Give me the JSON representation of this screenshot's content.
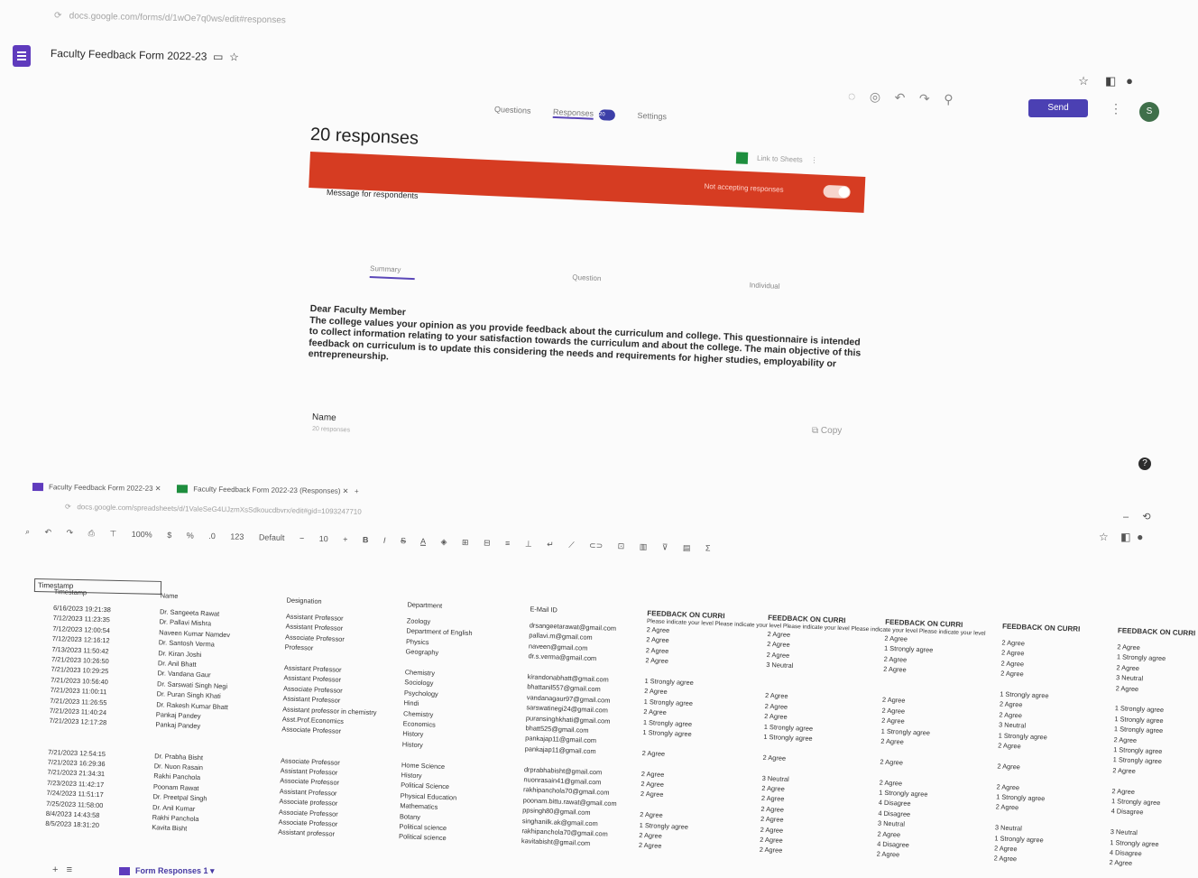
{
  "browser_top": {
    "url": "docs.google.com/forms/d/1wOe7q0ws/edit#responses",
    "form_title": "Faculty Feedback Form 2022-23",
    "send_label": "Send",
    "avatar_letter": "S",
    "tabs": [
      "Questions",
      "Responses",
      "Settings"
    ],
    "responses_badge": "20"
  },
  "responses": {
    "count_label": "20 responses",
    "link_sheets_label": "Link to Sheets",
    "accepting_label": "Not accepting responses",
    "message_label": "Message for respondents",
    "subtabs": [
      "Summary",
      "Question",
      "Individual"
    ],
    "paragraph_title": "Dear Faculty Member",
    "paragraph_text": "The college values your opinion as you provide feedback about the curriculum and college. This questionnaire is intended to collect information relating to your satisfaction towards the curriculum and about the college. The main objective of this feedback on curriculum is to update this considering the needs and requirements for higher studies, employability or entrepreneurship.",
    "name_label": "Name",
    "name_sub": "20 responses",
    "copy_label": "Copy"
  },
  "browser_bottom": {
    "tabs": [
      "Faculty Feedback Form 2022-23",
      "Faculty Feedback Form 2022-23 (Responses)"
    ],
    "url": "docs.google.com/spreadsheets/d/1ValeSeG4UJzmXsSdkoucdbvrx/edit#gid=1093247710",
    "zoom": "100%",
    "font": "Default",
    "font_size": "10",
    "name_box": "Timestamp",
    "sheet_tab": "Form Responses 1"
  },
  "sheet": {
    "headers": [
      "Timestamp",
      "Name",
      "Designation",
      "Department",
      "E-Mail ID",
      "FEEDBACK ON CURRI",
      "FEEDBACK ON CURRI",
      "FEEDBACK ON CURRI",
      "FEEDBACK ON CURRI",
      "FEEDBACK ON CURRI"
    ],
    "subheader": "Please indicate your level  Please indicate your level  Please indicate your level  Please indicate your level  Please indicate your level",
    "rows": [
      [
        "6/16/2023 19:21:38",
        "Dr. Sangeeta Rawat",
        "Assistant Professor",
        "Zoology",
        "drsangeetarawat@gmail.com",
        "2 Agree",
        "2 Agree",
        "2 Agree",
        "2 Agree",
        "2 Agree"
      ],
      [
        "7/12/2023 11:23:35",
        "Dr. Pallavi Mishra",
        "Assistant Professor",
        "Department of English",
        "pallavi.m@gmail.com",
        "2 Agree",
        "2 Agree",
        "1 Strongly agree",
        "2 Agree",
        "1 Strongly agree"
      ],
      [
        "7/12/2023 12:00:54",
        "Naveen Kumar Namdev",
        "Associate Professor",
        "Physics",
        "naveen@gmail.com",
        "2 Agree",
        "2 Agree",
        "2 Agree",
        "2 Agree",
        "2 Agree"
      ],
      [
        "7/12/2023 12:16:12",
        "Dr. Santosh Verma",
        "Professor",
        "Geography",
        "dr.s.verma@gmail.com",
        "2 Agree",
        "3 Neutral",
        "2 Agree",
        "2 Agree",
        "3 Neutral"
      ],
      [
        "7/13/2023 11:50:42",
        "Dr. Kiran Joshi",
        "",
        "",
        "",
        "",
        "",
        "",
        "",
        "2 Agree"
      ],
      [
        "7/21/2023 10:26:50",
        "Dr. Anil Bhatt",
        "Assistant Professor",
        "Chemistry",
        "kirandonabhatt@gmail.com",
        "1 Strongly agree",
        "",
        "",
        "1 Strongly agree",
        ""
      ],
      [
        "7/21/2023 10:29:25",
        "Dr. Vandana Gaur",
        "Assistant Professor",
        "Sociology",
        "bhattanil557@gmail.com",
        "2 Agree",
        "2 Agree",
        "2 Agree",
        "2 Agree",
        "1 Strongly agree"
      ],
      [
        "7/21/2023 10:56:40",
        "Dr. Sarswati Singh Negi",
        "Associate Professor",
        "Psychology",
        "vandanagaur97@gmail.com",
        "1 Strongly agree",
        "2 Agree",
        "2 Agree",
        "2 Agree",
        "1 Strongly agree"
      ],
      [
        "7/21/2023 11:00:11",
        "Dr. Puran Singh Khati",
        "Assistant Professor",
        "Hindi",
        "sarswatinegi24@gmail.com",
        "2 Agree",
        "2 Agree",
        "2 Agree",
        "3 Neutral",
        "1 Strongly agree"
      ],
      [
        "7/21/2023 11:26:55",
        "Dr. Rakesh Kumar Bhatt",
        "Assistant professor in chemistry",
        "Chemistry",
        "puransinghkhati@gmail.com",
        "1 Strongly agree",
        "1 Strongly agree",
        "1 Strongly agree",
        "1 Strongly agree",
        "2 Agree"
      ],
      [
        "7/21/2023 11:40:24",
        "Pankaj Pandey",
        "Asst.Prof.Economics",
        "Economics",
        "bhatt525@gmail.com",
        "1 Strongly agree",
        "1 Strongly agree",
        "2 Agree",
        "2 Agree",
        "1 Strongly agree"
      ],
      [
        "7/21/2023 12:17:28",
        "Pankaj Pandey",
        "Associate Professor",
        "History",
        "pankajap11@gmail.com",
        "",
        "",
        "",
        "",
        "1 Strongly agree"
      ],
      [
        "",
        "",
        "",
        "History",
        "pankajap11@gmail.com",
        "2 Agree",
        "2 Agree",
        "2 Agree",
        "2 Agree",
        "2 Agree"
      ],
      [
        "",
        "",
        "",
        "",
        "",
        "",
        "",
        "",
        "",
        ""
      ],
      [
        "7/21/2023 12:54:15",
        "Dr. Prabha Bisht",
        "Associate Professor",
        "Home Science",
        "drprabhabisht@gmail.com",
        "2 Agree",
        "3 Neutral",
        "2 Agree",
        "2 Agree",
        "2 Agree"
      ],
      [
        "7/21/2023 16:29:36",
        "Dr. Nuon Rasain",
        "Assistant Professor",
        "History",
        "nuonrasain41@gmail.com",
        "2 Agree",
        "2 Agree",
        "1 Strongly agree",
        "1 Strongly agree",
        "1 Strongly agree"
      ],
      [
        "7/21/2023 21:34:31",
        "Rakhi Panchola",
        "Associate Professor",
        "Political Science",
        "rakhipanchola70@gmail.com",
        "2 Agree",
        "2 Agree",
        "4 Disagree",
        "2 Agree",
        "4 Disagree"
      ],
      [
        "7/23/2023 11:42:17",
        "Poonam Rawat",
        "Assistant Professor",
        "Physical Education",
        "poonam.bittu.rawat@gmail.com",
        "",
        "2 Agree",
        "4 Disagree",
        "",
        ""
      ],
      [
        "7/24/2023 11:51:17",
        "Dr. Preetpal Singh",
        "Associate professor",
        "Mathematics",
        "ppsingh80@gmail.com",
        "2 Agree",
        "2 Agree",
        "3 Neutral",
        "3 Neutral",
        "3 Neutral"
      ],
      [
        "7/25/2023 11:58:00",
        "Dr. Anil Kumar",
        "Associate Professor",
        "Botany",
        "singhanilk.ak@gmail.com",
        "1 Strongly agree",
        "2 Agree",
        "2 Agree",
        "1 Strongly agree",
        "1 Strongly agree"
      ],
      [
        "8/4/2023 14:43:58",
        "Rakhi Panchola",
        "Associate Professor",
        "Political science",
        "rakhipanchola70@gmail.com",
        "2 Agree",
        "2 Agree",
        "4 Disagree",
        "2 Agree",
        "4 Disagree"
      ],
      [
        "8/5/2023 18:31:20",
        "Kavita Bisht",
        "Assistant professor",
        "Political science",
        "kavitabisht@gmail.com",
        "2 Agree",
        "2 Agree",
        "2 Agree",
        "2 Agree",
        "2 Agree"
      ]
    ]
  }
}
